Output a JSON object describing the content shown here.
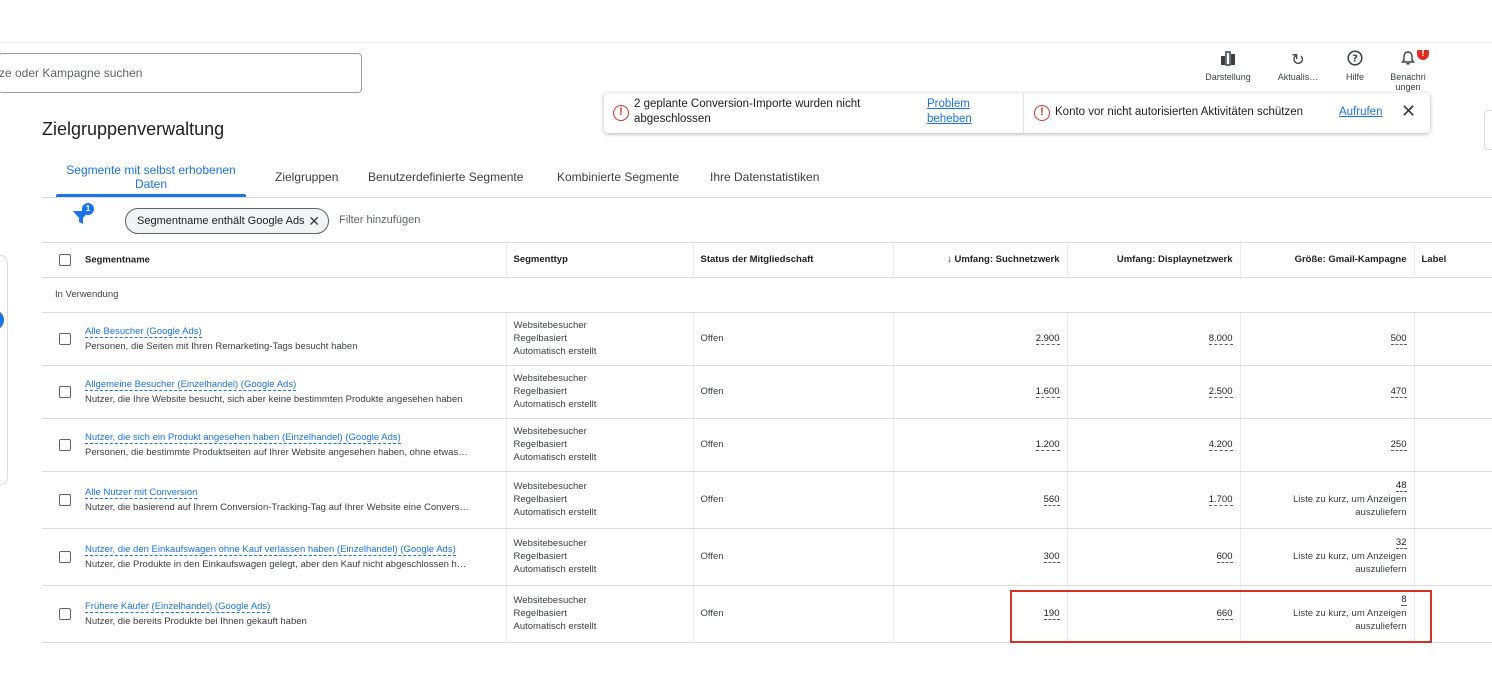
{
  "search": {
    "placeholder": "ze oder Kampagne suchen"
  },
  "toolbar": {
    "items": [
      {
        "label": "Darstellung",
        "icon": "bar-chart-icon"
      },
      {
        "label": "Aktualis…",
        "icon": "refresh-icon"
      },
      {
        "label": "Hilfe",
        "icon": "help-icon"
      },
      {
        "label": "Benachri\nungen",
        "icon": "bell-icon",
        "badge": "!"
      }
    ]
  },
  "alerts": [
    {
      "text": "2 geplante Conversion-Importe wurden nicht abgeschlossen",
      "link": "Problem beheben"
    },
    {
      "text": "Konto vor nicht autorisierten Aktivitäten schützen",
      "link": "Aufrufen"
    }
  ],
  "page": {
    "title": "Zielgruppenverwaltung"
  },
  "tabs": [
    {
      "label": "Segmente mit selbst erhobenen Daten",
      "active": true
    },
    {
      "label": "Zielgruppen"
    },
    {
      "label": "Benutzerdefinierte Segmente"
    },
    {
      "label": "Kombinierte Segmente"
    },
    {
      "label": "Ihre Datenstatistiken"
    }
  ],
  "filter": {
    "badge": "1",
    "chip": "Segmentname enthält Google Ads",
    "add": "Filter hinzufügen"
  },
  "table": {
    "columns": [
      "Segmentname",
      "Segmenttyp",
      "Status der Mitgliedschaft",
      "Umfang: Suchnetzwerk",
      "Umfang: Displaynetzwerk",
      "Größe: Gmail-Kampagne",
      "Label"
    ],
    "section": "In Verwendung",
    "rows": [
      {
        "name": "Alle Besucher (Google Ads)",
        "desc": "Personen, die Seiten mit Ihren Remarketing-Tags besucht haben",
        "type": [
          "Websitebesucher",
          "Regelbasiert",
          "Automatisch erstellt"
        ],
        "status": "Offen",
        "search": "2.900",
        "display": "8.000",
        "gmail": "500",
        "note": ""
      },
      {
        "name": "Allgemeine Besucher (Einzelhandel) (Google Ads)",
        "desc": "Nutzer, die Ihre Website besucht, sich aber keine bestimmten Produkte angesehen haben",
        "type": [
          "Websitebesucher",
          "Regelbasiert",
          "Automatisch erstellt"
        ],
        "status": "Offen",
        "search": "1.600",
        "display": "2.500",
        "gmail": "470",
        "note": ""
      },
      {
        "name": "Nutzer, die sich ein Produkt angesehen haben (Einzelhandel) (Google Ads)",
        "desc": "Personen, die bestimmte Produktseiten auf Ihrer Website angesehen haben, ohne etwas…",
        "type": [
          "Websitebesucher",
          "Regelbasiert",
          "Automatisch erstellt"
        ],
        "status": "Offen",
        "search": "1.200",
        "display": "4.200",
        "gmail": "250",
        "note": ""
      },
      {
        "name": "Alle Nutzer mit Conversion",
        "desc": "Nutzer, die basierend auf Ihrem Conversion-Tracking-Tag auf Ihrer Website eine Convers…",
        "type": [
          "Websitebesucher",
          "Regelbasiert",
          "Automatisch erstellt"
        ],
        "status": "Offen",
        "search": "560",
        "display": "1.700",
        "gmail": "48",
        "note": "Liste zu kurz, um Anzeigen auszuliefern"
      },
      {
        "name": "Nutzer, die den Einkaufswagen ohne Kauf verlassen haben (Einzelhandel) (Google Ads)",
        "desc": "Nutzer, die Produkte in den Einkaufswagen gelegt, aber den Kauf nicht abgeschlossen h…",
        "type": [
          "Websitebesucher",
          "Regelbasiert",
          "Automatisch erstellt"
        ],
        "status": "Offen",
        "search": "300",
        "display": "600",
        "gmail": "32",
        "note": "Liste zu kurz, um Anzeigen auszuliefern"
      },
      {
        "name": "Frühere Käufer (Einzelhandel) (Google Ads)",
        "desc": "Nutzer, die bereits Produkte bei Ihnen gekauft haben",
        "type": [
          "Websitebesucher",
          "Regelbasiert",
          "Automatisch erstellt"
        ],
        "status": "Offen",
        "search": "190",
        "display": "660",
        "gmail": "8",
        "note": "Liste zu kurz, um Anzeigen auszuliefern"
      }
    ]
  },
  "colors": {
    "accent": "#1a73e8",
    "error": "#d93025"
  }
}
